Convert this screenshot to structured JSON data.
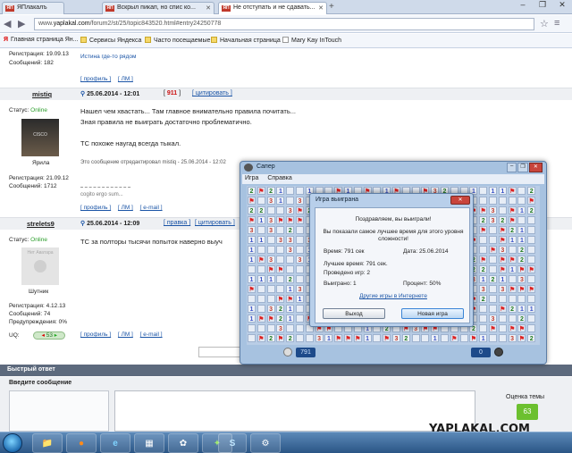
{
  "browser": {
    "tabs": [
      {
        "label": "ЯПлакалъ",
        "active": false
      },
      {
        "label": "Вскрыл пикап, но спис ко...",
        "active": false
      },
      {
        "label": "Не отступать и не сдавать...",
        "active": true
      }
    ],
    "tab_favicon": "ЯП",
    "url_prefix": "www.",
    "url_domain": "yaplakal.com",
    "url_rest": "/forum2/st/25/topic843520.html#entry24250778",
    "bookmarks": [
      "Главная страница Ян...",
      "Сервисы Яндекса",
      "Часто посещаемые",
      "Начальная страница",
      "Mary Kay InTouch"
    ],
    "window_controls": [
      "–",
      "❐",
      "✕"
    ]
  },
  "forum": {
    "top_user": {
      "reg": "Регистрация: 19.09.13",
      "msgs": "Сообщений: 182",
      "sig": "Истина где-то рядом"
    },
    "btns": [
      "[ профиль ]",
      "[ ЛМ ]"
    ],
    "post1": {
      "author": "mistiq",
      "date": "25.06.2014 - 12:01",
      "rating": "911",
      "quote": "[ цитировать ]",
      "status_label": "Статус:",
      "status": "Online",
      "avatar_caption": "Ярила",
      "avatar_text": "CISCO",
      "reg": "Регистрация: 21.09.12",
      "msgs": "Сообщений: 1712",
      "text": [
        "Нашел чем хвастать... Там главное внимательно правила почитать...",
        "Зная правила не выиграть достаточно проблематично.",
        "",
        "ТС похоже наугад всегда тыкал."
      ],
      "edited": "Это сообщение отредактировал mistiq - 25.06.2014 - 12:02",
      "signature": "cogito ergo sum...",
      "btns": [
        "[ профиль ]",
        "[ ЛМ ]",
        "[ e-mail ]"
      ]
    },
    "post2": {
      "author": "strelets9",
      "date": "25.06.2014 - 12:09",
      "edit": "[ правка ]",
      "quote": "[ цитировать ]",
      "status_label": "Статус:",
      "status": "Online",
      "avatar_text": "Нет Аватара",
      "avatar_caption": "Шутник",
      "reg": "Регистрация: 4.12.13",
      "msgs": "Сообщений: 74",
      "warn": "Предупреждения: 0%",
      "text": "ТС за полторы тысячи попыток наверно выуч",
      "uq_label": "UQ:",
      "uq": "53",
      "btns": [
        "[ профиль ]",
        "[ ЛМ ]",
        "[ e-mail ]"
      ]
    },
    "quick_reply": "Быстрый ответ",
    "enter_msg": "Введите сообщение",
    "rating_label": "Оценка темы",
    "rating_value": "63",
    "watermark": "YAPLAKAL.COM"
  },
  "saper": {
    "title": "Сапер",
    "menu": [
      "Игра",
      "Справка"
    ],
    "time_counter": "791",
    "mines_counter": "0"
  },
  "dialog": {
    "title": "Игра выиграна",
    "line1": "Поздравляем, вы выиграли!",
    "line2": "Вы показали самое лучшее время для этого уровня",
    "line3": "сложности!",
    "time": "Время: 791 сек",
    "date": "Дата: 25.06.2014",
    "best": "Лучшее время: 791 сек.",
    "played": "Проведено игр: 2",
    "won": "Выиграно: 1",
    "percent": "Процент: 50%",
    "link": "Другие игры в Интернете",
    "exit": "Выход",
    "new_game": "Новая игра"
  },
  "taskbar": {
    "items": [
      "📁",
      "●",
      "e",
      "▦",
      "✿",
      "S",
      "⚙"
    ]
  }
}
